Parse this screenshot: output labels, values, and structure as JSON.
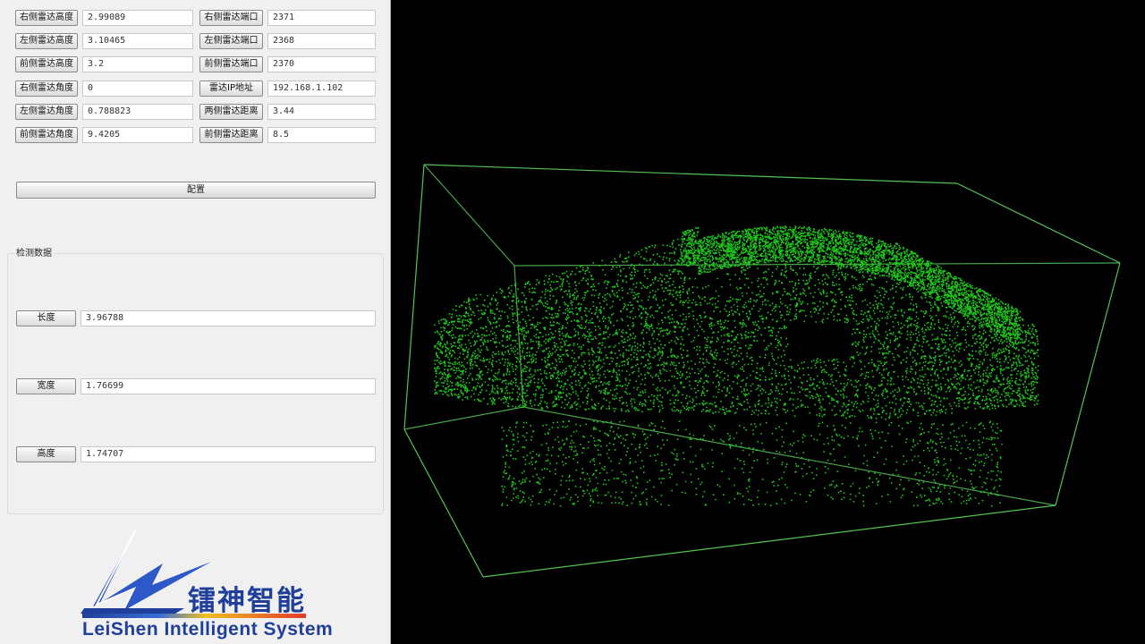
{
  "config": {
    "rows": [
      {
        "left_label": "右侧雷达高度",
        "left_value": "2.99089",
        "right_label": "右侧雷达端口",
        "right_value": "2371"
      },
      {
        "left_label": "左侧雷达高度",
        "left_value": "3.10465",
        "right_label": "左侧雷达端口",
        "right_value": "2368"
      },
      {
        "left_label": "前侧雷达高度",
        "left_value": "3.2",
        "right_label": "前侧雷达端口",
        "right_value": "2370"
      },
      {
        "left_label": "右侧雷达角度",
        "left_value": "0",
        "right_label": "雷达IP地址",
        "right_value": "192.168.1.102"
      },
      {
        "left_label": "左侧雷达角度",
        "left_value": "0.788823",
        "right_label": "两侧雷达距离",
        "right_value": "3.44"
      },
      {
        "left_label": "前侧雷达角度",
        "left_value": "9.4205",
        "right_label": "前侧雷达距离",
        "right_value": "8.5"
      }
    ],
    "configure_label": "配置"
  },
  "detection": {
    "title": "检测数据",
    "items": [
      {
        "label": "长度",
        "value": "3.96788"
      },
      {
        "label": "宽度",
        "value": "1.76699"
      },
      {
        "label": "高度",
        "value": "1.74707"
      }
    ]
  },
  "logo": {
    "cn": "镭神智能",
    "en": "LeiShen Intelligent System"
  },
  "viewport": {
    "background": "#000000",
    "point_color": "#22d81e",
    "box_color": "#55c255"
  }
}
